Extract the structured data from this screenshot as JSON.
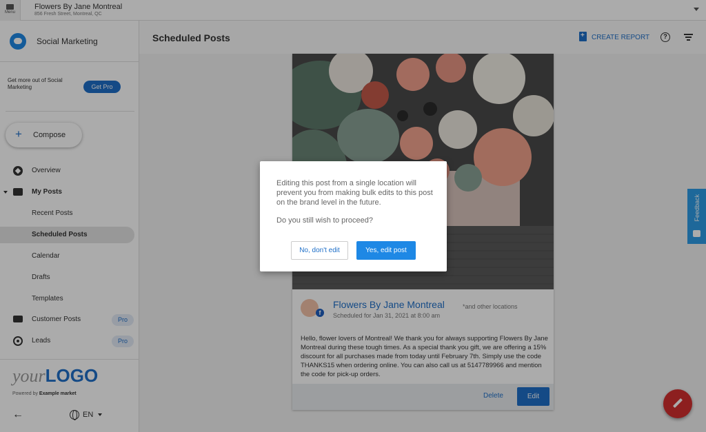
{
  "topbar": {
    "menu_label": "Menu",
    "business_name": "Flowers By Jane Montreal",
    "business_address": "856 Fresh Street, Montreal, QC"
  },
  "sidebar": {
    "app_title": "Social Marketing",
    "promo_text": "Get more out of Social Marketing",
    "get_pro_label": "Get Pro",
    "compose_label": "Compose",
    "items": [
      {
        "label": "Overview",
        "icon": "compass-icon"
      },
      {
        "label": "My Posts",
        "icon": "chat-icon"
      },
      {
        "label": "Recent Posts"
      },
      {
        "label": "Scheduled Posts",
        "active": true
      },
      {
        "label": "Calendar"
      },
      {
        "label": "Drafts"
      },
      {
        "label": "Templates"
      },
      {
        "label": "Customer Posts",
        "icon": "forum-icon",
        "badge": "Pro"
      },
      {
        "label": "Leads",
        "icon": "target-icon",
        "badge": "Pro"
      }
    ],
    "logo_your": "your",
    "logo_brand": "LOGO",
    "powered_by_prefix": "Powered by",
    "powered_by_name": "Example market",
    "language": "EN"
  },
  "header": {
    "title": "Scheduled Posts",
    "create_report_label": "CREATE REPORT"
  },
  "post": {
    "account_name": "Flowers By Jane Montreal",
    "other_locations": "*and other locations",
    "scheduled": "Scheduled for Jan 31, 2021 at 8:00 am",
    "body": "Hello, flower lovers of Montreal! We thank you for always supporting Flowers By Jane Montreal during these tough times. As a special thank you gift, we are offering a 15% discount for all purchases made from today until February 7th. Simply use the code THANKS15 when ordering online. You can also call us at 5147789966 and mention the code for pick-up orders.",
    "delete_label": "Delete",
    "edit_label": "Edit"
  },
  "feedback_label": "Feedback",
  "dialog": {
    "message": "Editing this post from a single location will prevent you from making bulk edits to this post on the brand level in the future.",
    "question": "Do you still wish to proceed?",
    "cancel_label": "No, don't edit",
    "confirm_label": "Yes, edit post"
  },
  "colors": {
    "accent": "#1e6fc8",
    "fab": "#d32f2f",
    "feedback": "#2d9be6"
  }
}
